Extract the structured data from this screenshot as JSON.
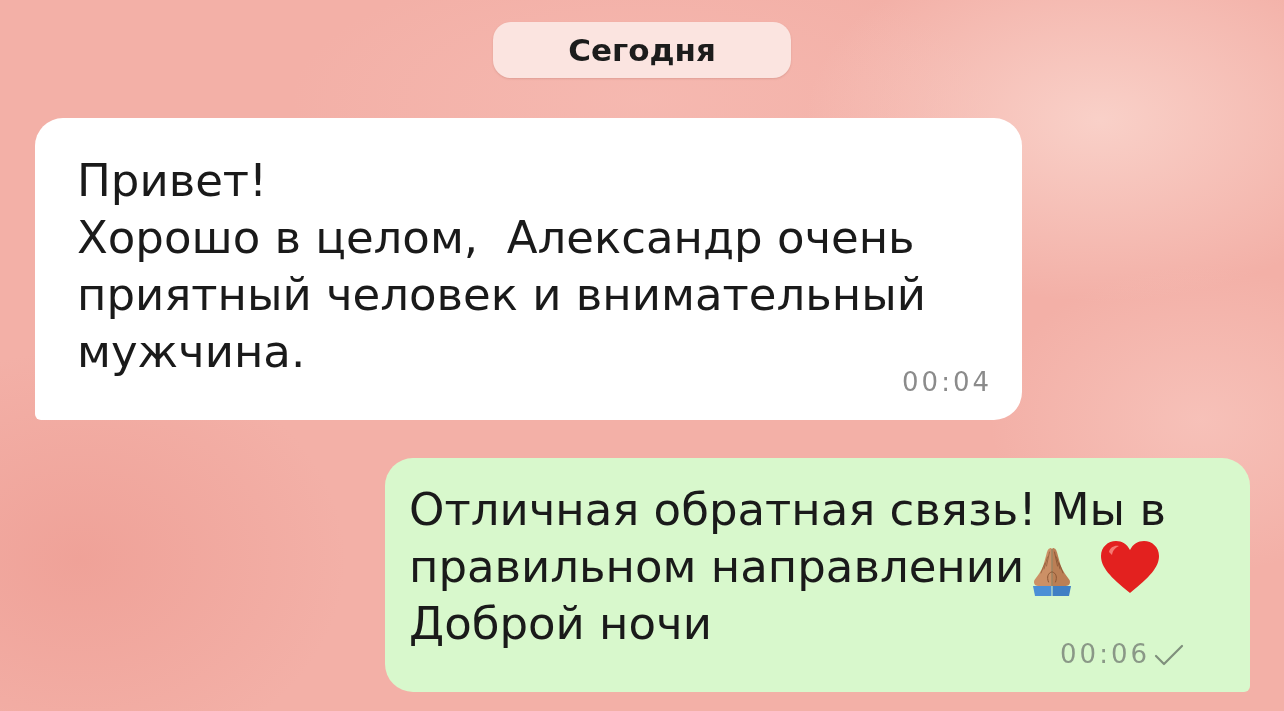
{
  "date_divider": {
    "label": "Сегодня"
  },
  "messages": [
    {
      "kind": "incoming",
      "lines": [
        {
          "text": "Привет!"
        },
        {
          "text": "Хорошо в целом,  Александр очень"
        },
        {
          "text": "приятный человек и внимательный"
        },
        {
          "text": "мужчина."
        }
      ],
      "time": "00:04",
      "sent": false
    },
    {
      "kind": "outgoing",
      "lines": [
        {
          "text": "Отличная обратная связь! Мы в"
        },
        {
          "text": "правильном направлении",
          "emoji": [
            {
              "kind": "pray"
            },
            {
              "kind": "heart"
            }
          ]
        },
        {
          "text": "Доброй ночи"
        }
      ],
      "time": "00:06",
      "sent": true
    }
  ]
}
